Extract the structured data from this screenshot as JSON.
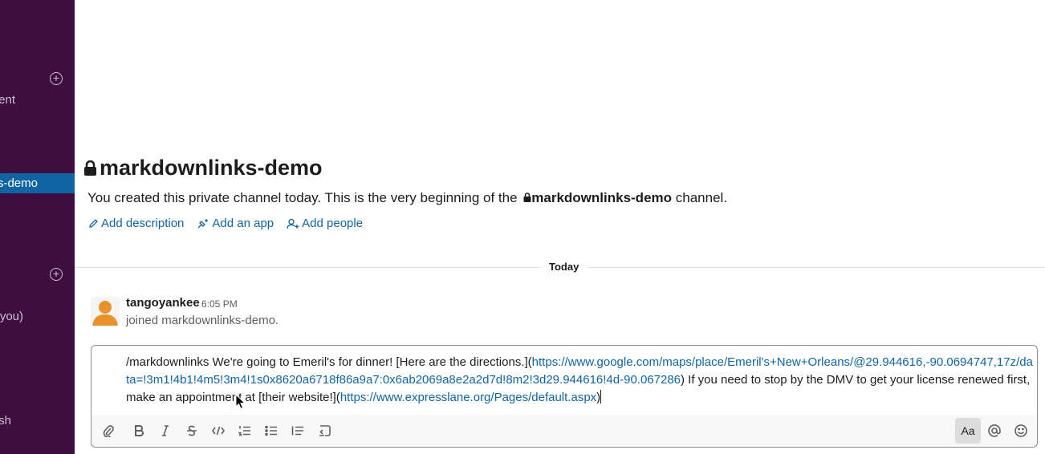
{
  "sidebar": {
    "item_ent": "ent",
    "active_channel": "s-demo",
    "item_you": "you)",
    "item_sh": "sh"
  },
  "channel": {
    "name": "markdownlinks-demo",
    "intro_prefix": "You created this private channel today. This is the very beginning of the",
    "intro_channel": "markdownlinks-demo",
    "intro_suffix": "channel.",
    "actions": [
      "Add description",
      "Add an app",
      "Add people"
    ]
  },
  "divider": {
    "label": "Today"
  },
  "message": {
    "author": "tangoyankee",
    "time": "6:05 PM",
    "text": "joined markdownlinks-demo."
  },
  "composer": {
    "part1": "/markdownlinks We're going to Emeril's for dinner! [Here are the directions.](",
    "link1": "https://www.google.com/maps/place/Emeril's+New+Orleans/@29.944616,-90.0694747,17z/data=!3m1!4b1!4m5!3m4!1s0x8620a6718f86a9a7:0x6ab2069a8e2a2d7d!8m2!3d29.944616!4d-90.067286",
    "part2": ") If you need to stop by the DMV to get your license renewed first, make an appointment at [their website!](",
    "link2": "https://www.expresslane.org/Pages/default.aspx",
    "part3": ")",
    "format_button": "Aa"
  },
  "colors": {
    "sidebar": "#3f0e40",
    "active": "#1164a3",
    "link": "#1264a3"
  }
}
